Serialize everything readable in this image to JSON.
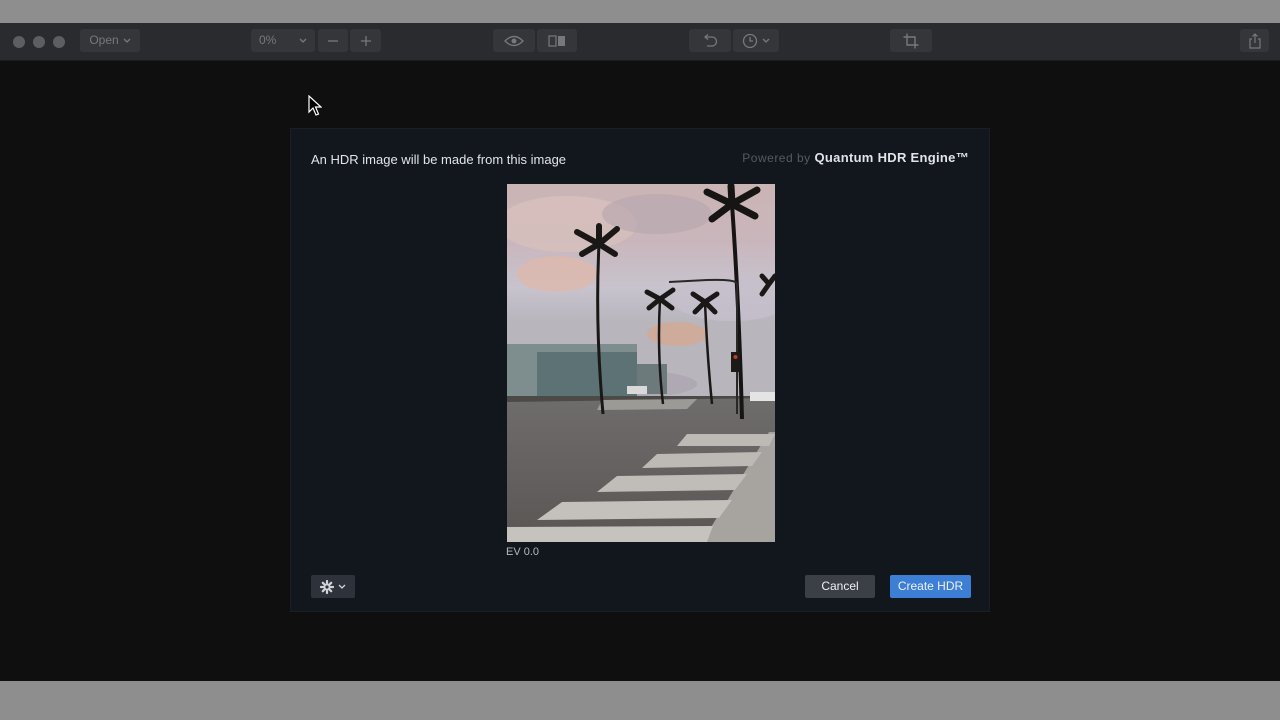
{
  "toolbar": {
    "open_label": "Open",
    "zoom_value": "0%",
    "icons": [
      "chevron-down-icon",
      "minus-icon",
      "plus-icon",
      "eye-icon",
      "compare-icon",
      "undo-icon",
      "history-icon",
      "crop-icon",
      "share-icon"
    ]
  },
  "dialog": {
    "title": "An HDR image will be made from this image",
    "powered_by": "Powered by",
    "engine_name": "Quantum HDR Engine™",
    "exposure_label": "EV 0.0",
    "cancel_label": "Cancel",
    "create_label": "Create HDR"
  },
  "colors": {
    "accent": "#3c7fd4",
    "dialog_bg": "#12161d",
    "toolbar_bg": "#2a2b2e"
  }
}
